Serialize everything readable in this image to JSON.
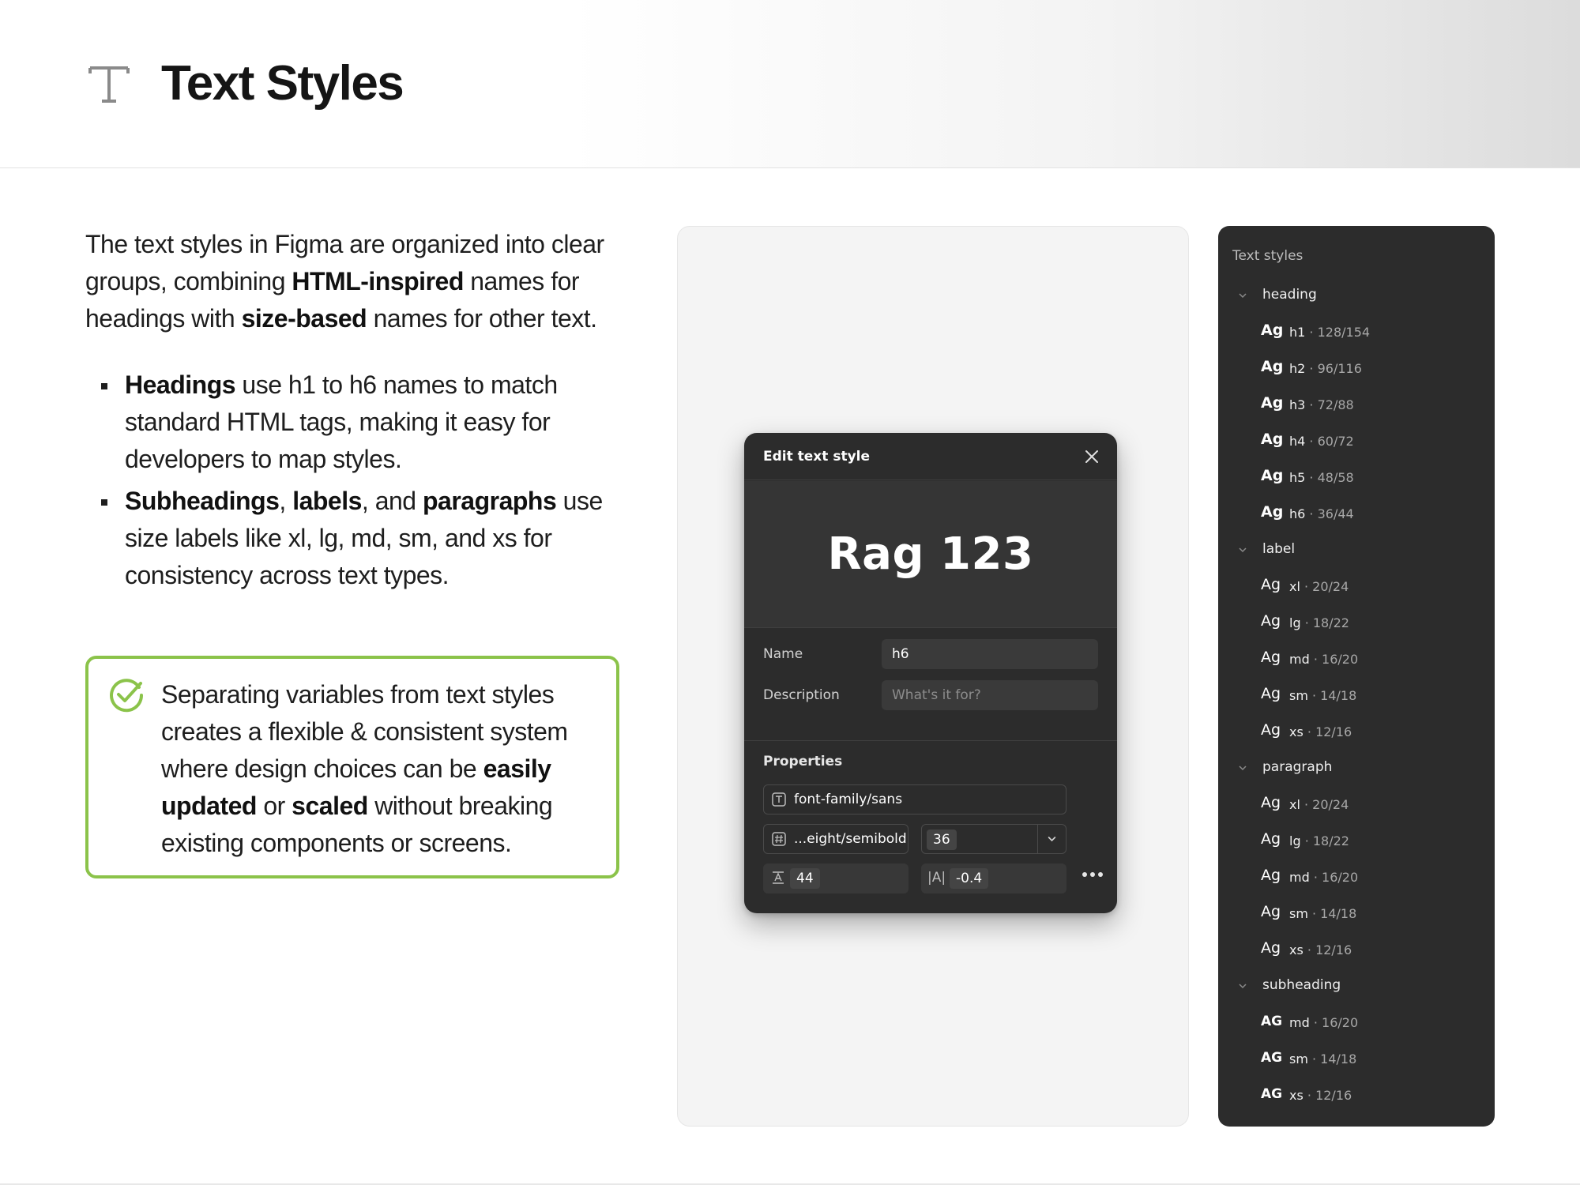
{
  "header": {
    "title": "Text Styles",
    "icon": "text-type-icon"
  },
  "intro": {
    "p1": "The text styles in Figma are organized into clear groups, combining ",
    "b1": "HTML-inspired",
    "p2": " names for headings with ",
    "b2": "size-based",
    "p3": " names for other text."
  },
  "bullets": [
    {
      "b": "Headings",
      "t": " use h1 to h6 names to match standard HTML tags, making it easy for developers to map styles."
    },
    {
      "b1": "Subheadings",
      "t1": ", ",
      "b2": "labels",
      "t2": ", and ",
      "b3": "paragraphs",
      "t3": " use size labels like xl, lg, md, sm, and xs for consistency across text types."
    }
  ],
  "note": {
    "icon": "check-circle-icon",
    "p1": "Separating variables from text styles creates a flexible & consistent system where design choices can be ",
    "b1": "easily updated",
    "p2": " or ",
    "b2": "scaled",
    "p3": " without breaking existing components or screens."
  },
  "colors": {
    "note_border": "#8bc34a",
    "dark_surface": "#2c2c2c",
    "canvas": "#f4f4f4"
  },
  "modal": {
    "title": "Edit text style",
    "preview": "Rag 123",
    "name_label": "Name",
    "name_value": "h6",
    "description_label": "Description",
    "description_placeholder": "What's it for?",
    "properties_label": "Properties",
    "font_family": "font-family/sans",
    "font_weight": "...eight/semibold",
    "font_size": "36",
    "line_height": "44",
    "letter_spacing_glyph": "|A|",
    "letter_spacing": "-0.4"
  },
  "panel": {
    "title": "Text styles",
    "groups": {
      "heading": {
        "name": "heading",
        "items": [
          {
            "ag": "Ag",
            "name": "h1",
            "spec": " · 128/154"
          },
          {
            "ag": "Ag",
            "name": "h2",
            "spec": " · 96/116"
          },
          {
            "ag": "Ag",
            "name": "h3",
            "spec": " · 72/88"
          },
          {
            "ag": "Ag",
            "name": "h4",
            "spec": " · 60/72"
          },
          {
            "ag": "Ag",
            "name": "h5",
            "spec": " · 48/58"
          },
          {
            "ag": "Ag",
            "name": "h6",
            "spec": " · 36/44"
          }
        ]
      },
      "label": {
        "name": "label",
        "items": [
          {
            "ag": "Ag",
            "name": "xl",
            "spec": " · 20/24"
          },
          {
            "ag": "Ag",
            "name": "lg",
            "spec": " · 18/22"
          },
          {
            "ag": "Ag",
            "name": "md",
            "spec": " · 16/20"
          },
          {
            "ag": "Ag",
            "name": "sm",
            "spec": " · 14/18"
          },
          {
            "ag": "Ag",
            "name": "xs",
            "spec": " · 12/16"
          }
        ]
      },
      "paragraph": {
        "name": "paragraph",
        "items": [
          {
            "ag": "Ag",
            "name": "xl",
            "spec": " · 20/24"
          },
          {
            "ag": "Ag",
            "name": "lg",
            "spec": " · 18/22"
          },
          {
            "ag": "Ag",
            "name": "md",
            "spec": " · 16/20"
          },
          {
            "ag": "Ag",
            "name": "sm",
            "spec": " · 14/18"
          },
          {
            "ag": "Ag",
            "name": "xs",
            "spec": " · 12/16"
          }
        ]
      },
      "subheading": {
        "name": "subheading",
        "items": [
          {
            "ag": "AG",
            "name": "md",
            "spec": " · 16/20"
          },
          {
            "ag": "AG",
            "name": "sm",
            "spec": " · 14/18"
          },
          {
            "ag": "AG",
            "name": "xs",
            "spec": " · 12/16"
          }
        ]
      }
    }
  }
}
